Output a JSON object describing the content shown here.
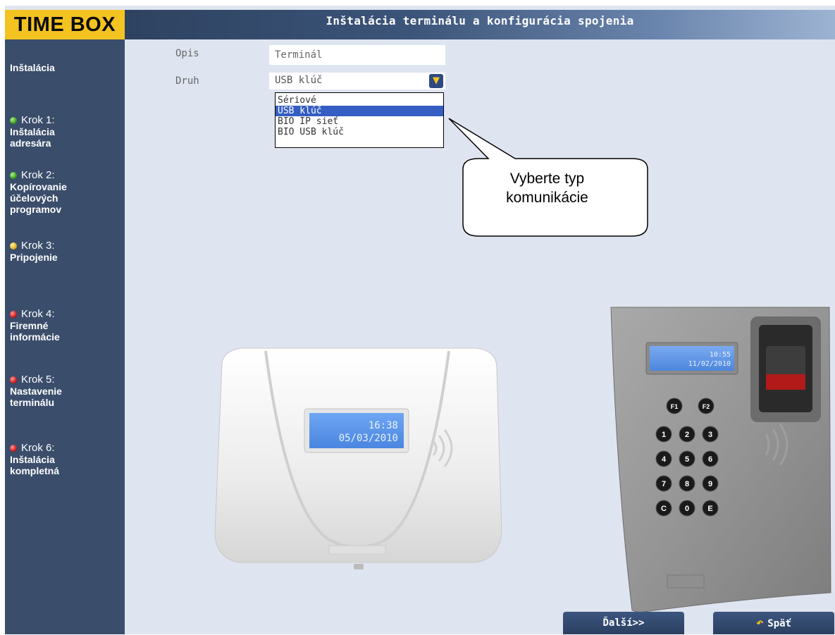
{
  "app": {
    "logo": "TIME BOX",
    "title": "Inštalácia terminálu a konfigurácia spojenia"
  },
  "sidebar": {
    "heading": "Inštalácia",
    "steps": [
      {
        "label": "Krok 1:",
        "desc": [
          "Inštalácia",
          "adresára"
        ],
        "status": "green"
      },
      {
        "label": "Krok 2:",
        "desc": [
          "Kopírovanie",
          "účelových",
          "programov"
        ],
        "status": "green"
      },
      {
        "label": "Krok 3:",
        "desc": [
          "Pripojenie"
        ],
        "status": "yellow"
      },
      {
        "label": "Krok 4:",
        "desc": [
          "Firemné",
          "informácie"
        ],
        "status": "red"
      },
      {
        "label": "Krok 5:",
        "desc": [
          "Nastavenie",
          "terminálu"
        ],
        "status": "red"
      },
      {
        "label": "Krok 6:",
        "desc": [
          "Inštalácia",
          "kompletná"
        ],
        "status": "red"
      }
    ]
  },
  "form": {
    "opis_label": "Opis",
    "opis_value": "Terminál",
    "druh_label": "Druh",
    "druh_value": "USB klúč",
    "options": [
      "Sériové",
      "USB klúč",
      "BIO IP sieť",
      "BIO USB klúč"
    ],
    "selected_index": 1
  },
  "callout": {
    "lines": [
      "Vyberte typ",
      "komunikácie"
    ]
  },
  "devices": {
    "terminal1": {
      "time": "16:38",
      "date": "05/03/2010"
    },
    "terminal2": {
      "time": "10:55",
      "date": "11/02/2010",
      "keys": [
        "F1",
        "F2",
        "1",
        "2",
        "3",
        "4",
        "5",
        "6",
        "7",
        "8",
        "9",
        "C",
        "0",
        "E"
      ]
    }
  },
  "buttons": {
    "next": "Ďalší>>",
    "back": "Späť"
  },
  "colors": {
    "sidebar": "#3a4d6b",
    "logo_bg": "#f3c321",
    "content_bg": "#dfe5f0",
    "selected": "#355ec3"
  }
}
